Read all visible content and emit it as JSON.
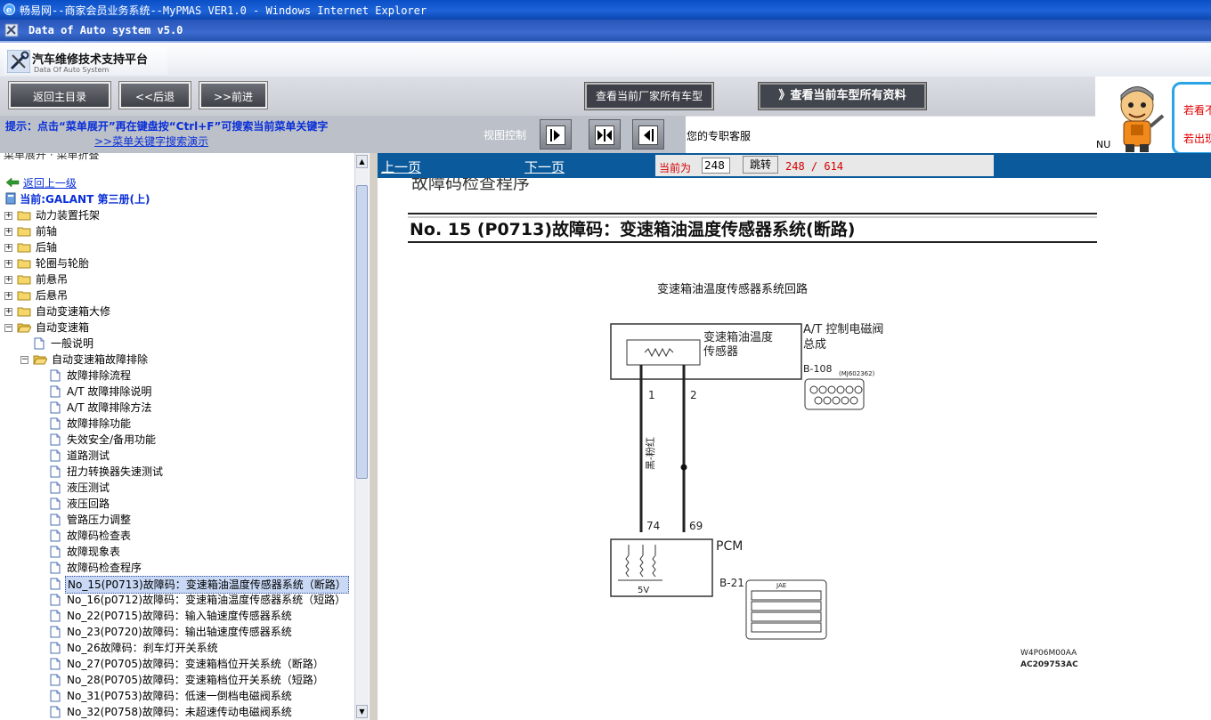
{
  "window": {
    "ie_title": "畅易网--商家会员业务系统--MyPMAS VER1.0 - Windows Internet Explorer",
    "app_title": "Data of Auto system v5.0"
  },
  "header": {
    "logo_title": "汽车维修技术支持平台",
    "logo_subtitle": "Data Of Auto System"
  },
  "toolbar": {
    "home_label": "返回主目录",
    "back_label": "<<后退",
    "forward_label": ">>前进",
    "all_models_label": "查看当前厂家所有车型",
    "all_data_label": "》查看当前车型所有资料"
  },
  "hint": {
    "text": "提示：点击“菜单展开”再在键盘按“Ctrl+F”可搜索当前菜单关键字",
    "link": ">>菜单关键字搜索演示",
    "view_control": "视图控制"
  },
  "service": {
    "text": "您的专职客服",
    "prefix": "NU"
  },
  "side_ad": {
    "line1": "若看不",
    "line2": "若出现"
  },
  "tree": {
    "menu_header": "菜单展开  ·  菜单折叠",
    "back_up": "返回上一级",
    "current": "当前:GALANT 第三册(上)",
    "top_items": [
      "动力装置托架",
      "前轴",
      "后轴",
      "轮圈与轮胎",
      "前悬吊",
      "后悬吊",
      "自动变速箱大修",
      "自动变速箱"
    ],
    "level2": [
      "一般说明",
      "自动变速箱故障排除"
    ],
    "level3": [
      "故障排除流程",
      "A/T 故障排除说明",
      "A/T 故障排除方法",
      "故障排除功能",
      "失效安全/备用功能",
      "道路测试",
      "扭力转换器失速测试",
      "液压测试",
      "液压回路",
      "管路压力调整",
      "故障码检查表",
      "故障现象表",
      "故障码检查程序",
      "No_15(P0713)故障码：变速箱油温度传感器系统（断路）",
      "No_16(p0712)故障码：变速箱油温度传感器系统（短路）",
      "No_22(P0715)故障码：输入轴速度传感器系统",
      "No_23(P0720)故障码：输出轴速度传感器系统",
      "No_26故障码：刹车灯开关系统",
      "No_27(P0705)故障码：变速箱档位开关系统（断路）",
      "No_28(P0705)故障码：变速箱档位开关系统（短路）",
      "No_31(P0753)故障码：低速一倒档电磁阀系统",
      "No_32(P0758)故障码：未超速传动电磁阀系统"
    ],
    "selected_index": 13
  },
  "pager": {
    "prev": "上一页",
    "next": "下一页",
    "current_label": "当前为",
    "page_value": "248",
    "go_label": "跳转",
    "page_count": "248 / 614"
  },
  "doc": {
    "prev_heading": "故障码检查程序",
    "title": "No. 15 (P0713)故障码：变速箱油温度传感器系统(断路)",
    "diagram_title": "变速箱油温度传感器系统回路",
    "sensor_label_1": "变速箱油温度",
    "sensor_label_2": "传感器",
    "valve_label_1": "A/T 控制电磁阀",
    "valve_label_2": "总成",
    "connector_b108": "B-108",
    "connector_part": "(MJ602362)",
    "pin_1": "1",
    "pin_2": "2",
    "pin_74": "74",
    "pin_69": "69",
    "wire_color_1": "黑-粉红",
    "pcm_label": "PCM",
    "connector_b21": "B-21",
    "jae_label": "JAE",
    "voltage_5v": "5V",
    "ref_1": "W4P06M00AA",
    "ref_2": "AC209753AC"
  },
  "colors": {
    "ie_blue": "#0a4fc5",
    "hint_blue": "#0a2fd8",
    "bar_blue": "#0b5a9c",
    "red_text": "#d80000"
  }
}
